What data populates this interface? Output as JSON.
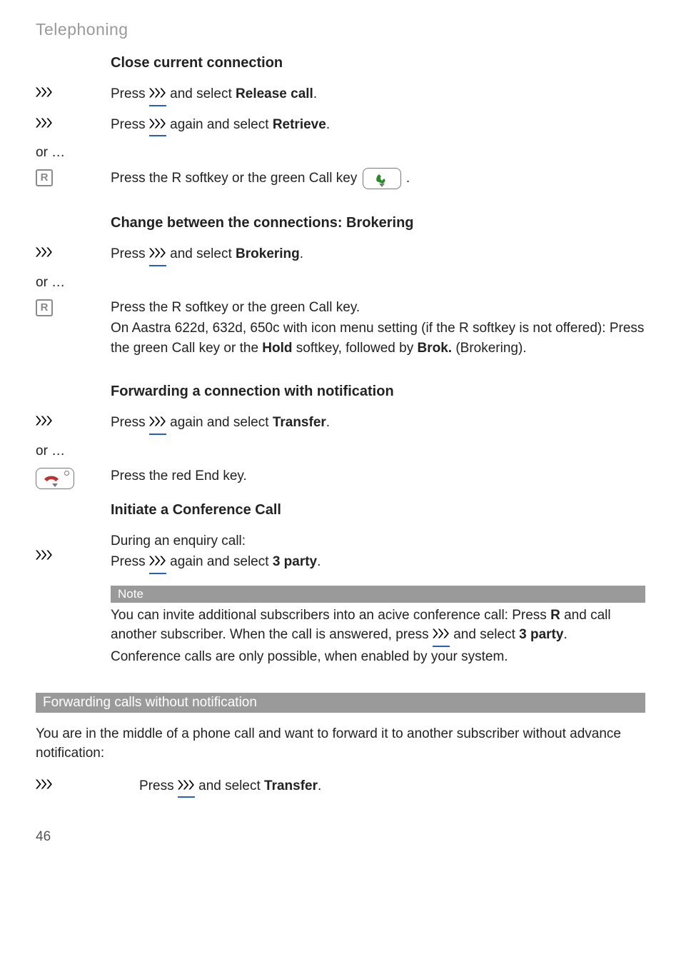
{
  "running_head": "Telephoning",
  "sections": {
    "close": {
      "heading": "Close current connection",
      "step1_pre": "Press ",
      "step1_post": " and select ",
      "step1_strong": "Release call",
      "step1_end": ".",
      "step2_pre": "Press ",
      "step2_mid": " again and select ",
      "step2_strong": "Retrieve",
      "step2_end": ".",
      "or": "or …",
      "step3_pre": "Press the R softkey or the green Call key ",
      "step3_post": " ."
    },
    "brokering": {
      "heading": "Change between the connections: Brokering",
      "step1_pre": "Press ",
      "step1_mid": "  and select ",
      "step1_strong": "Brokering",
      "step1_end": ".",
      "or": "or …",
      "step2_l1": "Press the R softkey or the green Call key.",
      "step2_l2_pre": "On Aastra 622d, 632d, 650c with icon menu setting (if the R softkey is not offered): Press the green Call key or the ",
      "step2_l2_b1": "Hold",
      "step2_l2_mid": " softkey, followed by ",
      "step2_l2_b2": "Brok.",
      "step2_l2_end": " (Brokering)."
    },
    "fwd_notif": {
      "heading": "Forwarding a connection with notification",
      "step1_pre": "Press ",
      "step1_mid": "  again and select ",
      "step1_strong": "Transfer",
      "step1_end": ".",
      "or": "or …",
      "step2": "Press the red End key."
    },
    "conference": {
      "heading": "Initiate a Conference Call",
      "line1": "During an enquiry call:",
      "line2_pre": "Press ",
      "line2_mid": "  again and select ",
      "line2_strong": "3 party",
      "line2_end": ".",
      "note_label": "Note",
      "note_pre": "You can invite additional subscribers into an acive conference call: Press ",
      "note_b1": "R",
      "note_mid1": " and call another subscriber. When the call is answered, press ",
      "note_mid2": " and select ",
      "note_b2": "3 party",
      "note_end": ".",
      "note_l3": "Conference calls are only possible, when enabled by your system."
    },
    "fwd_without": {
      "band": "Forwarding calls without notification",
      "para": "You are in the middle of a phone call and want to forward it to another subscriber without advance notification:",
      "step_pre": "Press ",
      "step_mid": " and select ",
      "step_strong": "Transfer",
      "step_end": "."
    }
  },
  "page_number": "46",
  "icons": {
    "chevrons": "chevrons-icon",
    "r_box": "R",
    "endkey": "end-key-icon",
    "callkey": "call-key-icon"
  }
}
